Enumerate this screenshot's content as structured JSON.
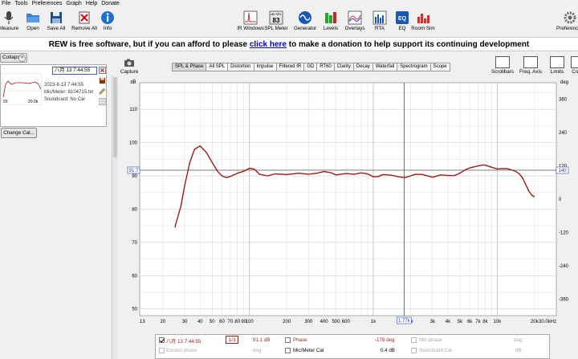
{
  "menu": [
    "File",
    "Tools",
    "Preferences",
    "Graph",
    "Help",
    "Donate"
  ],
  "toolbar": {
    "left": [
      {
        "label": "Measure",
        "icon": "microphone-icon"
      },
      {
        "label": "Open",
        "icon": "folder-open-icon"
      },
      {
        "label": "Save All",
        "icon": "save-icon"
      },
      {
        "label": "Remove All",
        "icon": "remove-all-icon"
      },
      {
        "label": "Info",
        "icon": "info-icon"
      }
    ],
    "center": [
      {
        "label": "IR Windows",
        "icon": "ir-windows-icon"
      },
      {
        "label": "SPL Meter",
        "icon": "spl-meter-icon"
      },
      {
        "label": "Generator",
        "icon": "generator-icon"
      },
      {
        "label": "Levels",
        "icon": "levels-icon"
      },
      {
        "label": "Overlays",
        "icon": "overlays-icon"
      },
      {
        "label": "RTA",
        "icon": "rta-icon"
      },
      {
        "label": "EQ",
        "icon": "eq-icon"
      },
      {
        "label": "Room Sim",
        "icon": "room-sim-icon"
      }
    ],
    "spl_meter_value": "83",
    "spl_meter_unit": "dB SPL",
    "eq_badge": "EQ",
    "preferences_label": "Preferences"
  },
  "banner": {
    "text_before": "REW is free software, but if you can afford to please ",
    "link": "click here",
    "text_after": " to make a donation to help support its continuing development"
  },
  "left_panel": {
    "collapse_label": "Collapse",
    "measurement_title": "八月 13 7:44:55",
    "date": "2023-8-13 7:44:55",
    "mic": "Mic/Meter: 8104715.txt",
    "soundcard": "Soundcard: No Cal",
    "thumb_axis": [
      "20",
      "20.0k"
    ],
    "change_cal_label": "Change Cal..."
  },
  "capture_label": "Capture",
  "tabs": [
    "SPL & Phase",
    "All SPL",
    "Distortion",
    "Impulse",
    "Filtered IR",
    "GD",
    "RT60",
    "Clarity",
    "Decay",
    "Waterfall",
    "Spectrogram",
    "Scope"
  ],
  "active_tab": "SPL & Phase",
  "right_tools": [
    {
      "label": "Scrollbars",
      "icon": "scrollbars-icon"
    },
    {
      "label": "Freq. Axis",
      "icon": "freq-axis-icon"
    },
    {
      "label": "Limits",
      "icon": "limits-icon"
    },
    {
      "label": "Contr",
      "icon": "controls-icon"
    }
  ],
  "graph": {
    "left_unit": "dB",
    "right_unit": "deg",
    "left_ticks": [
      {
        "v": 110,
        "t": "110"
      },
      {
        "v": 100,
        "t": "100"
      },
      {
        "v": 90,
        "t": "90"
      },
      {
        "v": 80,
        "t": "80"
      },
      {
        "v": 70,
        "t": "70"
      },
      {
        "v": 60,
        "t": "60"
      },
      {
        "v": 50,
        "t": "50"
      }
    ],
    "right_ticks": [
      {
        "v": 360,
        "t": "360"
      },
      {
        "v": 240,
        "t": "240"
      },
      {
        "v": 120,
        "t": "120"
      },
      {
        "v": 0,
        "t": "0"
      },
      {
        "v": -120,
        "t": "-120"
      },
      {
        "v": -240,
        "t": "-240"
      },
      {
        "v": -360,
        "t": "-360"
      }
    ],
    "x_labels": [
      {
        "f": 13,
        "t": "13"
      },
      {
        "f": 20,
        "t": "20"
      },
      {
        "f": 30,
        "t": "30"
      },
      {
        "f": 40,
        "t": "40"
      },
      {
        "f": 50,
        "t": "50"
      },
      {
        "f": 60,
        "t": "60"
      },
      {
        "f": 70,
        "t": "70"
      },
      {
        "f": 80,
        "t": "80"
      },
      {
        "f": 90,
        "t": "90"
      },
      {
        "f": 100,
        "t": "100"
      },
      {
        "f": 200,
        "t": "200"
      },
      {
        "f": 300,
        "t": "300"
      },
      {
        "f": 400,
        "t": "400"
      },
      {
        "f": 500,
        "t": "500"
      },
      {
        "f": 600,
        "t": "600"
      },
      {
        "f": 1000,
        "t": "1k"
      },
      {
        "f": 2000,
        "t": "2k"
      },
      {
        "f": 3000,
        "t": "3k"
      },
      {
        "f": 4000,
        "t": "4k"
      },
      {
        "f": 5000,
        "t": "5k"
      },
      {
        "f": 6000,
        "t": "6k"
      },
      {
        "f": 7000,
        "t": "7k"
      },
      {
        "f": 8000,
        "t": "8k"
      },
      {
        "f": 10000,
        "t": "10k"
      },
      {
        "f": 20000,
        "t": "20k"
      },
      {
        "f": 30000,
        "t": "30.0kHz"
      }
    ],
    "cursor_db_label": "91.7",
    "cursor_deg_label": "140",
    "cursor_freq_label": "1.77k",
    "cursor_freq": 1770,
    "cursor_db": 91.7,
    "trace_color": "#9e1a1a"
  },
  "chart_data": {
    "type": "line",
    "x_scale": "log",
    "xlim": [
      13,
      30000
    ],
    "ylim": [
      48,
      118
    ],
    "y2lim": [
      -420,
      420
    ],
    "series": [
      {
        "x": [
          25,
          28,
          30,
          33,
          36,
          40,
          45,
          50,
          55,
          60,
          65,
          70,
          80,
          90,
          100,
          110,
          120,
          140,
          160,
          200,
          250,
          300,
          350,
          400,
          450,
          500,
          600,
          700,
          800,
          900,
          1000,
          1100,
          1200,
          1400,
          1600,
          1800,
          2000,
          2200,
          2500,
          3000,
          3500,
          4000,
          4500,
          5000,
          5500,
          6000,
          7000,
          7700,
          8000,
          9000,
          10000,
          11000,
          12000,
          13000,
          14000,
          15000,
          16000,
          17000,
          18000,
          19000,
          20000
        ],
        "y": [
          74.5,
          81,
          87,
          94,
          98,
          99,
          97,
          94,
          91.5,
          90,
          89.5,
          89.8,
          90.8,
          91.4,
          92.3,
          92,
          90.5,
          90,
          90.6,
          90.4,
          90.8,
          90.5,
          90.8,
          91.3,
          91,
          90.3,
          90.7,
          90.5,
          90.9,
          90.6,
          89.7,
          89.8,
          90.4,
          90.2,
          89.7,
          89.5,
          90,
          90.5,
          90.4,
          89.6,
          90.3,
          90.1,
          90.1,
          90.8,
          91.8,
          92.4,
          93,
          93.3,
          93.2,
          92.6,
          92.1,
          92.2,
          92.2,
          91.8,
          91.4,
          90.7,
          89.4,
          87.4,
          85.4,
          84.2,
          83.7
        ]
      }
    ]
  },
  "legend": {
    "trace_name": "八月 13 7:44:55",
    "smoothing": "1/3",
    "trace_value": "91.1 dB",
    "phase_label": "Phase",
    "phase_value": "-178 deg",
    "min_phase_label": "Min phase",
    "min_phase_unit": "deg",
    "excess_phase_label": "Excess phase",
    "excess_phase_unit": "deg",
    "micmeter_cal_label": "Mic/Meter Cal",
    "micmeter_cal_value": "0.4 dB",
    "soundcard_cal_label": "Soundcard Cal",
    "soundcard_cal_unit": "dB"
  }
}
